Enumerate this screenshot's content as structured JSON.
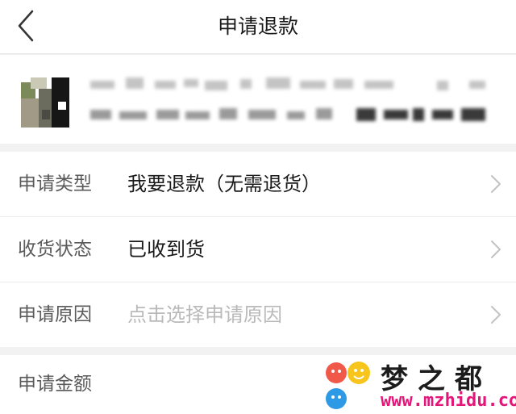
{
  "nav": {
    "title": "申请退款",
    "back_icon": "chevron-left-icon"
  },
  "product": {
    "thumbnail": "product-thumbnail-obscured",
    "text_obscured": true
  },
  "form": {
    "rows": [
      {
        "label": "申请类型",
        "value": "我要退款（无需退货）",
        "placeholder": false
      },
      {
        "label": "收货状态",
        "value": "已收到货",
        "placeholder": false
      },
      {
        "label": "申请原因",
        "value": "点击选择申请原因",
        "placeholder": true
      }
    ],
    "amount_label": "申请金额"
  },
  "watermark": {
    "name": "梦之都",
    "url": "www.mzhidu.com"
  },
  "colors": {
    "background": "#f2f2f2",
    "panel": "#ffffff",
    "text_primary": "#1a1a1a",
    "text_label": "#5a5a5a",
    "placeholder": "#b9b9b9",
    "watermark_url": "#e4167a"
  }
}
